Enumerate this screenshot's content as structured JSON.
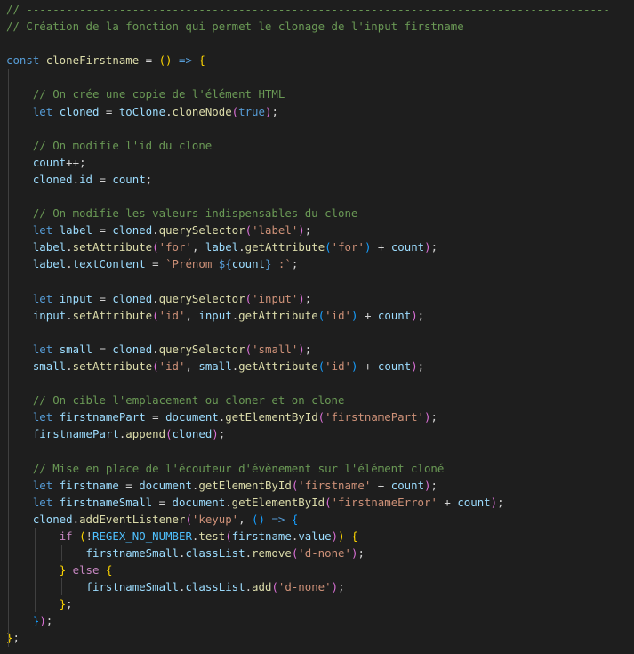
{
  "editor": {
    "theme": "dark",
    "colors": {
      "background": "#1e1e1e",
      "comment": "#6a9955",
      "keyword": "#569cd6",
      "variable": "#9cdcfe",
      "function": "#dcdcaa",
      "string": "#ce9178",
      "control": "#c586c0",
      "constant": "#4fc1ff",
      "bracket_1": "#ffd700",
      "bracket_2": "#da70d6",
      "bracket_3": "#179fff"
    },
    "lines": [
      [
        [
          "c",
          "// ----------------------------------------------------------------------------------------"
        ]
      ],
      [
        [
          "c",
          "// Création de la fonction qui permet le clonage de l'input firstname"
        ]
      ],
      [],
      [
        [
          "k",
          "const "
        ],
        [
          "fn",
          "cloneFirstname"
        ],
        [
          "o",
          " = "
        ],
        [
          "p",
          "()"
        ],
        [
          "o",
          " "
        ],
        [
          "k",
          "=>"
        ],
        [
          "o",
          " "
        ],
        [
          "p",
          "{"
        ]
      ],
      [],
      [
        [
          "o",
          "    "
        ],
        [
          "c",
          "// On crée une copie de l'élément HTML"
        ]
      ],
      [
        [
          "o",
          "    "
        ],
        [
          "k",
          "let "
        ],
        [
          "v",
          "cloned"
        ],
        [
          "o",
          " = "
        ],
        [
          "v",
          "toClone"
        ],
        [
          "o",
          "."
        ],
        [
          "fn",
          "cloneNode"
        ],
        [
          "p2",
          "("
        ],
        [
          "k",
          "true"
        ],
        [
          "p2",
          ")"
        ],
        [
          "o",
          ";"
        ]
      ],
      [],
      [
        [
          "o",
          "    "
        ],
        [
          "c",
          "// On modifie l'id du clone"
        ]
      ],
      [
        [
          "o",
          "    "
        ],
        [
          "v",
          "count"
        ],
        [
          "o",
          "++;"
        ]
      ],
      [
        [
          "o",
          "    "
        ],
        [
          "v",
          "cloned"
        ],
        [
          "o",
          "."
        ],
        [
          "v",
          "id"
        ],
        [
          "o",
          " = "
        ],
        [
          "v",
          "count"
        ],
        [
          "o",
          ";"
        ]
      ],
      [],
      [
        [
          "o",
          "    "
        ],
        [
          "c",
          "// On modifie les valeurs indispensables du clone"
        ]
      ],
      [
        [
          "o",
          "    "
        ],
        [
          "k",
          "let "
        ],
        [
          "v",
          "label"
        ],
        [
          "o",
          " = "
        ],
        [
          "v",
          "cloned"
        ],
        [
          "o",
          "."
        ],
        [
          "fn",
          "querySelector"
        ],
        [
          "p2",
          "("
        ],
        [
          "s",
          "'label'"
        ],
        [
          "p2",
          ")"
        ],
        [
          "o",
          ";"
        ]
      ],
      [
        [
          "o",
          "    "
        ],
        [
          "v",
          "label"
        ],
        [
          "o",
          "."
        ],
        [
          "fn",
          "setAttribute"
        ],
        [
          "p2",
          "("
        ],
        [
          "s",
          "'for'"
        ],
        [
          "o",
          ", "
        ],
        [
          "v",
          "label"
        ],
        [
          "o",
          "."
        ],
        [
          "fn",
          "getAttribute"
        ],
        [
          "p3",
          "("
        ],
        [
          "s",
          "'for'"
        ],
        [
          "p3",
          ")"
        ],
        [
          "o",
          " + "
        ],
        [
          "v",
          "count"
        ],
        [
          "p2",
          ")"
        ],
        [
          "o",
          ";"
        ]
      ],
      [
        [
          "o",
          "    "
        ],
        [
          "v",
          "label"
        ],
        [
          "o",
          "."
        ],
        [
          "v",
          "textContent"
        ],
        [
          "o",
          " = "
        ],
        [
          "s",
          "`Prénom "
        ],
        [
          "k",
          "${"
        ],
        [
          "v",
          "count"
        ],
        [
          "k",
          "}"
        ],
        [
          "s",
          " :`"
        ],
        [
          "o",
          ";"
        ]
      ],
      [],
      [
        [
          "o",
          "    "
        ],
        [
          "k",
          "let "
        ],
        [
          "v",
          "input"
        ],
        [
          "o",
          " = "
        ],
        [
          "v",
          "cloned"
        ],
        [
          "o",
          "."
        ],
        [
          "fn",
          "querySelector"
        ],
        [
          "p2",
          "("
        ],
        [
          "s",
          "'input'"
        ],
        [
          "p2",
          ")"
        ],
        [
          "o",
          ";"
        ]
      ],
      [
        [
          "o",
          "    "
        ],
        [
          "v",
          "input"
        ],
        [
          "o",
          "."
        ],
        [
          "fn",
          "setAttribute"
        ],
        [
          "p2",
          "("
        ],
        [
          "s",
          "'id'"
        ],
        [
          "o",
          ", "
        ],
        [
          "v",
          "input"
        ],
        [
          "o",
          "."
        ],
        [
          "fn",
          "getAttribute"
        ],
        [
          "p3",
          "("
        ],
        [
          "s",
          "'id'"
        ],
        [
          "p3",
          ")"
        ],
        [
          "o",
          " + "
        ],
        [
          "v",
          "count"
        ],
        [
          "p2",
          ")"
        ],
        [
          "o",
          ";"
        ]
      ],
      [],
      [
        [
          "o",
          "    "
        ],
        [
          "k",
          "let "
        ],
        [
          "v",
          "small"
        ],
        [
          "o",
          " = "
        ],
        [
          "v",
          "cloned"
        ],
        [
          "o",
          "."
        ],
        [
          "fn",
          "querySelector"
        ],
        [
          "p2",
          "("
        ],
        [
          "s",
          "'small'"
        ],
        [
          "p2",
          ")"
        ],
        [
          "o",
          ";"
        ]
      ],
      [
        [
          "o",
          "    "
        ],
        [
          "v",
          "small"
        ],
        [
          "o",
          "."
        ],
        [
          "fn",
          "setAttribute"
        ],
        [
          "p2",
          "("
        ],
        [
          "s",
          "'id'"
        ],
        [
          "o",
          ", "
        ],
        [
          "v",
          "small"
        ],
        [
          "o",
          "."
        ],
        [
          "fn",
          "getAttribute"
        ],
        [
          "p3",
          "("
        ],
        [
          "s",
          "'id'"
        ],
        [
          "p3",
          ")"
        ],
        [
          "o",
          " + "
        ],
        [
          "v",
          "count"
        ],
        [
          "p2",
          ")"
        ],
        [
          "o",
          ";"
        ]
      ],
      [],
      [
        [
          "o",
          "    "
        ],
        [
          "c",
          "// On cible l'emplacement ou cloner et on clone"
        ]
      ],
      [
        [
          "o",
          "    "
        ],
        [
          "k",
          "let "
        ],
        [
          "v",
          "firstnamePart"
        ],
        [
          "o",
          " = "
        ],
        [
          "v",
          "document"
        ],
        [
          "o",
          "."
        ],
        [
          "fn",
          "getElementById"
        ],
        [
          "p2",
          "("
        ],
        [
          "s",
          "'firstnamePart'"
        ],
        [
          "p2",
          ")"
        ],
        [
          "o",
          ";"
        ]
      ],
      [
        [
          "o",
          "    "
        ],
        [
          "v",
          "firstnamePart"
        ],
        [
          "o",
          "."
        ],
        [
          "fn",
          "append"
        ],
        [
          "p2",
          "("
        ],
        [
          "v",
          "cloned"
        ],
        [
          "p2",
          ")"
        ],
        [
          "o",
          ";"
        ]
      ],
      [],
      [
        [
          "o",
          "    "
        ],
        [
          "c",
          "// Mise en place de l'écouteur d'évènement sur l'élément cloné"
        ]
      ],
      [
        [
          "o",
          "    "
        ],
        [
          "k",
          "let "
        ],
        [
          "v",
          "firstname"
        ],
        [
          "o",
          " = "
        ],
        [
          "v",
          "document"
        ],
        [
          "o",
          "."
        ],
        [
          "fn",
          "getElementById"
        ],
        [
          "p2",
          "("
        ],
        [
          "s",
          "'firstname'"
        ],
        [
          "o",
          " + "
        ],
        [
          "v",
          "count"
        ],
        [
          "p2",
          ")"
        ],
        [
          "o",
          ";"
        ]
      ],
      [
        [
          "o",
          "    "
        ],
        [
          "k",
          "let "
        ],
        [
          "v",
          "firstnameSmall"
        ],
        [
          "o",
          " = "
        ],
        [
          "v",
          "document"
        ],
        [
          "o",
          "."
        ],
        [
          "fn",
          "getElementById"
        ],
        [
          "p2",
          "("
        ],
        [
          "s",
          "'firstnameError'"
        ],
        [
          "o",
          " + "
        ],
        [
          "v",
          "count"
        ],
        [
          "p2",
          ")"
        ],
        [
          "o",
          ";"
        ]
      ],
      [
        [
          "o",
          "    "
        ],
        [
          "v",
          "cloned"
        ],
        [
          "o",
          "."
        ],
        [
          "fn",
          "addEventListener"
        ],
        [
          "p2",
          "("
        ],
        [
          "s",
          "'keyup'"
        ],
        [
          "o",
          ", "
        ],
        [
          "p3",
          "()"
        ],
        [
          "o",
          " "
        ],
        [
          "k",
          "=>"
        ],
        [
          "o",
          " "
        ],
        [
          "p3",
          "{"
        ]
      ],
      [
        [
          "o",
          "        "
        ],
        [
          "ctl",
          "if "
        ],
        [
          "p",
          "("
        ],
        [
          "o",
          "!"
        ],
        [
          "cst",
          "REGEX_NO_NUMBER"
        ],
        [
          "o",
          "."
        ],
        [
          "fn",
          "test"
        ],
        [
          "p2",
          "("
        ],
        [
          "v",
          "firstname"
        ],
        [
          "o",
          "."
        ],
        [
          "v",
          "value"
        ],
        [
          "p2",
          ")"
        ],
        [
          "p",
          ")"
        ],
        [
          "o",
          " "
        ],
        [
          "p",
          "{"
        ]
      ],
      [
        [
          "o",
          "            "
        ],
        [
          "v",
          "firstnameSmall"
        ],
        [
          "o",
          "."
        ],
        [
          "v",
          "classList"
        ],
        [
          "o",
          "."
        ],
        [
          "fn",
          "remove"
        ],
        [
          "p2",
          "("
        ],
        [
          "s",
          "'d-none'"
        ],
        [
          "p2",
          ")"
        ],
        [
          "o",
          ";"
        ]
      ],
      [
        [
          "o",
          "        "
        ],
        [
          "p",
          "}"
        ],
        [
          "o",
          " "
        ],
        [
          "ctl",
          "else "
        ],
        [
          "p",
          "{"
        ]
      ],
      [
        [
          "o",
          "            "
        ],
        [
          "v",
          "firstnameSmall"
        ],
        [
          "o",
          "."
        ],
        [
          "v",
          "classList"
        ],
        [
          "o",
          "."
        ],
        [
          "fn",
          "add"
        ],
        [
          "p2",
          "("
        ],
        [
          "s",
          "'d-none'"
        ],
        [
          "p2",
          ")"
        ],
        [
          "o",
          ";"
        ]
      ],
      [
        [
          "o",
          "        "
        ],
        [
          "p",
          "}"
        ],
        [
          "o",
          ";"
        ]
      ],
      [
        [
          "o",
          "    "
        ],
        [
          "p3",
          "}"
        ],
        [
          "p2",
          ")"
        ],
        [
          "o",
          ";"
        ]
      ],
      [
        [
          "p",
          "}"
        ],
        [
          "o",
          ";"
        ]
      ]
    ],
    "indent_guides": [
      {
        "from": 4,
        "to": 37,
        "col": 0
      },
      {
        "from": 31,
        "to": 35,
        "col": 1
      },
      {
        "from": 32,
        "to": 32,
        "col": 2
      },
      {
        "from": 34,
        "to": 34,
        "col": 2
      }
    ]
  }
}
